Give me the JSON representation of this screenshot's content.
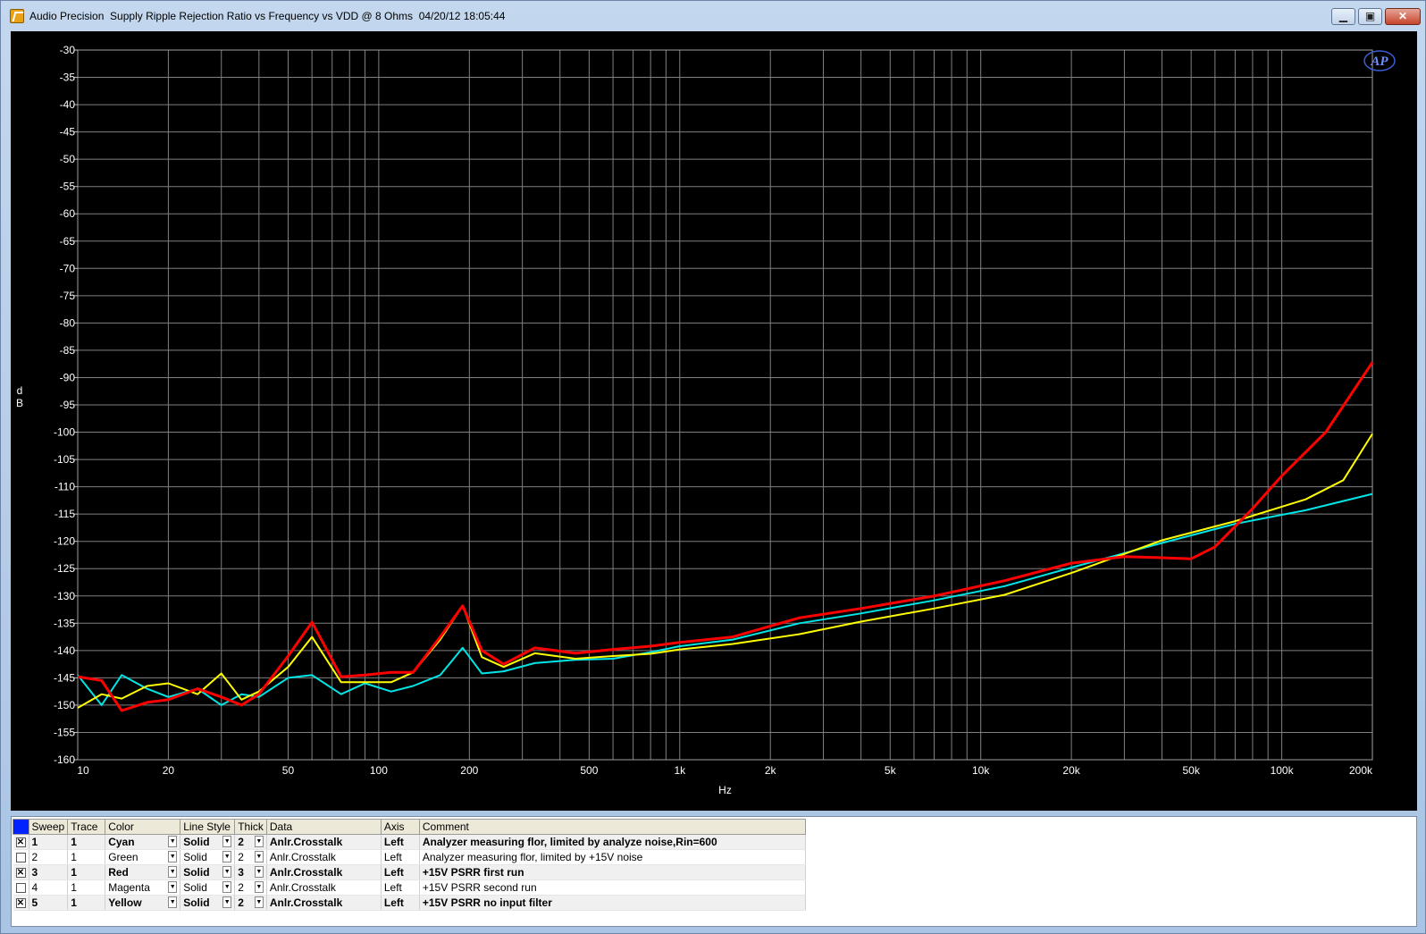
{
  "window": {
    "title": "Audio Precision  Supply Ripple Rejection Ratio vs Frequency vs VDD @ 8 Ohms  04/20/12 18:05:44",
    "min_glyph": "▁",
    "max_glyph": "▣",
    "close_glyph": "✕"
  },
  "logo": {
    "text": "AP"
  },
  "chart_data": {
    "type": "line",
    "xlabel": "Hz",
    "ylabel": "dB",
    "xscale": "log",
    "xlim": [
      10,
      200000
    ],
    "ylim": [
      -160,
      -30
    ],
    "grid": true,
    "background": "#000000",
    "grid_color": "#808080",
    "y_ticks": [
      -30,
      -35,
      -40,
      -45,
      -50,
      -55,
      -60,
      -65,
      -70,
      -75,
      -80,
      -85,
      -90,
      -95,
      -100,
      -105,
      -110,
      -115,
      -120,
      -125,
      -130,
      -135,
      -140,
      -145,
      -150,
      -155,
      -160
    ],
    "x_ticks": [
      {
        "value": 10,
        "label": "10"
      },
      {
        "value": 20,
        "label": "20"
      },
      {
        "value": 50,
        "label": "50"
      },
      {
        "value": 100,
        "label": "100"
      },
      {
        "value": 200,
        "label": "200"
      },
      {
        "value": 500,
        "label": "500"
      },
      {
        "value": 1000,
        "label": "1k"
      },
      {
        "value": 2000,
        "label": "2k"
      },
      {
        "value": 5000,
        "label": "5k"
      },
      {
        "value": 10000,
        "label": "10k"
      },
      {
        "value": 20000,
        "label": "20k"
      },
      {
        "value": 50000,
        "label": "50k"
      },
      {
        "value": 100000,
        "label": "100k"
      },
      {
        "value": 200000,
        "label": "200k"
      }
    ],
    "series": [
      {
        "color": "#00e5e5",
        "width": 2,
        "points": [
          [
            10,
            -144.5
          ],
          [
            12,
            -150
          ],
          [
            14,
            -144.5
          ],
          [
            17,
            -147
          ],
          [
            20,
            -148.5
          ],
          [
            25,
            -147
          ],
          [
            30,
            -150
          ],
          [
            35,
            -148
          ],
          [
            40,
            -148.5
          ],
          [
            50,
            -145
          ],
          [
            60,
            -144.5
          ],
          [
            75,
            -148
          ],
          [
            90,
            -146
          ],
          [
            110,
            -147.5
          ],
          [
            130,
            -146.5
          ],
          [
            160,
            -144.5
          ],
          [
            190,
            -139.5
          ],
          [
            220,
            -144.2
          ],
          [
            260,
            -143.8
          ],
          [
            330,
            -142.3
          ],
          [
            450,
            -141.7
          ],
          [
            600,
            -141.5
          ],
          [
            800,
            -140.3
          ],
          [
            1000,
            -139.2
          ],
          [
            1500,
            -138
          ],
          [
            2500,
            -135
          ],
          [
            4000,
            -133.2
          ],
          [
            7000,
            -130.8
          ],
          [
            12000,
            -128.2
          ],
          [
            20000,
            -124.8
          ],
          [
            40000,
            -120.3
          ],
          [
            70000,
            -116.8
          ],
          [
            120000,
            -114.3
          ],
          [
            200000,
            -111.3
          ]
        ]
      },
      {
        "color": "#ffff00",
        "width": 2,
        "points": [
          [
            10,
            -150.5
          ],
          [
            12,
            -148
          ],
          [
            14,
            -148.8
          ],
          [
            17,
            -146.5
          ],
          [
            20,
            -146
          ],
          [
            25,
            -148
          ],
          [
            30,
            -144.2
          ],
          [
            35,
            -149
          ],
          [
            40,
            -147.5
          ],
          [
            50,
            -143
          ],
          [
            60,
            -137.5
          ],
          [
            75,
            -145.8
          ],
          [
            90,
            -145.8
          ],
          [
            110,
            -145.8
          ],
          [
            130,
            -144
          ],
          [
            160,
            -138
          ],
          [
            190,
            -131.8
          ],
          [
            220,
            -141.2
          ],
          [
            260,
            -143
          ],
          [
            330,
            -140.5
          ],
          [
            450,
            -141.5
          ],
          [
            600,
            -141
          ],
          [
            800,
            -140.6
          ],
          [
            1000,
            -139.8
          ],
          [
            1500,
            -138.8
          ],
          [
            2500,
            -137
          ],
          [
            4000,
            -134.7
          ],
          [
            7000,
            -132.3
          ],
          [
            12000,
            -129.8
          ],
          [
            20000,
            -125.8
          ],
          [
            40000,
            -119.8
          ],
          [
            70000,
            -116.3
          ],
          [
            120000,
            -112.3
          ],
          [
            160000,
            -108.8
          ],
          [
            200000,
            -100.3
          ]
        ]
      },
      {
        "color": "#ff0000",
        "width": 3,
        "points": [
          [
            10,
            -144.8
          ],
          [
            12,
            -145.5
          ],
          [
            14,
            -151
          ],
          [
            17,
            -149.5
          ],
          [
            20,
            -149
          ],
          [
            25,
            -147
          ],
          [
            30,
            -148.5
          ],
          [
            35,
            -150
          ],
          [
            40,
            -148
          ],
          [
            50,
            -141
          ],
          [
            60,
            -134.8
          ],
          [
            75,
            -144.8
          ],
          [
            90,
            -144.5
          ],
          [
            110,
            -144
          ],
          [
            130,
            -144
          ],
          [
            160,
            -137.5
          ],
          [
            190,
            -131.8
          ],
          [
            220,
            -140
          ],
          [
            260,
            -142.5
          ],
          [
            330,
            -139.5
          ],
          [
            450,
            -140.5
          ],
          [
            600,
            -139.8
          ],
          [
            800,
            -139.2
          ],
          [
            1000,
            -138.5
          ],
          [
            1500,
            -137.5
          ],
          [
            2500,
            -134
          ],
          [
            4000,
            -132.3
          ],
          [
            7000,
            -130
          ],
          [
            12000,
            -127.2
          ],
          [
            20000,
            -124
          ],
          [
            30000,
            -122.8
          ],
          [
            40000,
            -123
          ],
          [
            50000,
            -123.2
          ],
          [
            60000,
            -121
          ],
          [
            80000,
            -114
          ],
          [
            100000,
            -108
          ],
          [
            140000,
            -100
          ],
          [
            200000,
            -87.2
          ]
        ]
      }
    ]
  },
  "legend_table": {
    "headers": [
      "Sweep",
      "Trace",
      "Color",
      "Line Style",
      "Thick",
      "Data",
      "Axis",
      "Comment"
    ],
    "rows": [
      {
        "active": true,
        "checked": "✕",
        "sweep": "1",
        "trace": "1",
        "color": "Cyan",
        "style": "Solid",
        "thick": "2",
        "data": "Anlr.Crosstalk",
        "axis": "Left",
        "comment": "Analyzer measuring flor, limited by analyze noise,Rin=600"
      },
      {
        "active": false,
        "checked": "",
        "sweep": "2",
        "trace": "1",
        "color": "Green",
        "style": "Solid",
        "thick": "2",
        "data": "Anlr.Crosstalk",
        "axis": "Left",
        "comment": "Analyzer measuring flor, limited by +15V noise"
      },
      {
        "active": true,
        "checked": "✕",
        "sweep": "3",
        "trace": "1",
        "color": "Red",
        "style": "Solid",
        "thick": "3",
        "data": "Anlr.Crosstalk",
        "axis": "Left",
        "comment": "+15V PSRR first run"
      },
      {
        "active": false,
        "checked": "",
        "sweep": "4",
        "trace": "1",
        "color": "Magenta",
        "style": "Solid",
        "thick": "2",
        "data": "Anlr.Crosstalk",
        "axis": "Left",
        "comment": "+15V PSRR second run"
      },
      {
        "active": true,
        "checked": "✕",
        "sweep": "5",
        "trace": "1",
        "color": "Yellow",
        "style": "Solid",
        "thick": "2",
        "data": "Anlr.Crosstalk",
        "axis": "Left",
        "comment": "+15V PSRR no input filter"
      }
    ]
  }
}
